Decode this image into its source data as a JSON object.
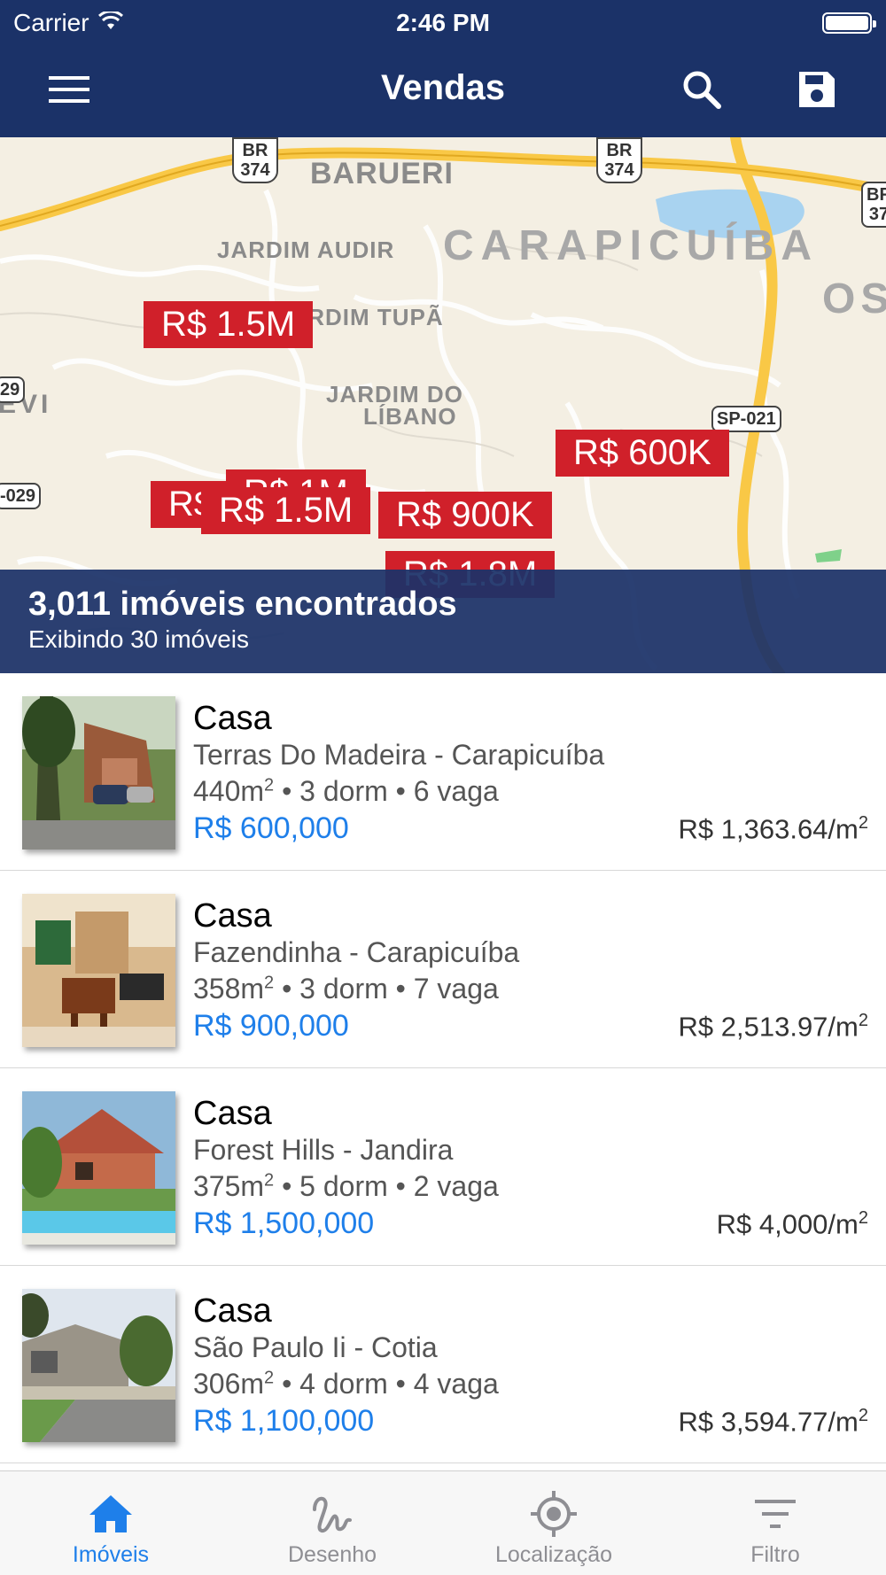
{
  "status_bar": {
    "carrier": "Carrier",
    "time": "2:46 PM"
  },
  "nav": {
    "title": "Vendas",
    "menu_icon": "hamburger-menu-icon",
    "search_icon": "search-icon",
    "save_icon": "save-icon"
  },
  "map": {
    "labels": {
      "barueri": "BARUERI",
      "carapicuiba": "CARAPICUÍBA",
      "jardim_audir": "JARDIM AUDIR",
      "jardim_tupa": "JARDIM TUPÃ",
      "jardim_do": "JARDIM DO",
      "libano": "LÍBANO",
      "evi": "EVI",
      "os": "OS"
    },
    "shields": {
      "br374_left": "BR\n374",
      "br374_right": "BR\n374",
      "br_edge": "BR\n37",
      "sp021": "SP-021",
      "r29": "29",
      "r029": "-029"
    },
    "pins": {
      "p1": "R$ 1.5M",
      "p2": "R$ 600K",
      "p3": "R$",
      "p4": "R$ 1M",
      "p5": "R$ 1.5M",
      "p6": "R$ 900K",
      "p7": "R$ 1.8M"
    },
    "results_count": "3,011 imóveis encontrados",
    "results_shown": "Exibindo 30 imóveis"
  },
  "listings": [
    {
      "type": "Casa",
      "location": "Terras Do Madeira - Carapicuíba",
      "area": "440",
      "dorm": "3 dorm",
      "vaga": "6 vaga",
      "price": "R$ 600,000",
      "price_per_m2": "R$ 1,363.64/m"
    },
    {
      "type": "Casa",
      "location": "Fazendinha - Carapicuíba",
      "area": "358",
      "dorm": "3 dorm",
      "vaga": "7 vaga",
      "price": "R$ 900,000",
      "price_per_m2": "R$ 2,513.97/m"
    },
    {
      "type": "Casa",
      "location": "Forest Hills - Jandira",
      "area": "375",
      "dorm": "5 dorm",
      "vaga": "2 vaga",
      "price": "R$ 1,500,000",
      "price_per_m2": "R$ 4,000/m"
    },
    {
      "type": "Casa",
      "location": "São Paulo Ii - Cotia",
      "area": "306",
      "dorm": "4 dorm",
      "vaga": "4 vaga",
      "price": "R$ 1,100,000",
      "price_per_m2": "R$ 3,594.77/m"
    }
  ],
  "units": {
    "m": "m",
    "sup": "2",
    "sep": " • "
  },
  "tabs": [
    {
      "label": "Imóveis",
      "icon": "home-icon",
      "active": true
    },
    {
      "label": "Desenho",
      "icon": "draw-icon",
      "active": false
    },
    {
      "label": "Localização",
      "icon": "location-icon",
      "active": false
    },
    {
      "label": "Filtro",
      "icon": "filter-icon",
      "active": false
    }
  ],
  "colors": {
    "header": "#1b3268",
    "pin": "#d0202a",
    "price": "#1e7fea",
    "tab_active": "#1e7fea",
    "tab_inactive": "#8e8e93"
  }
}
